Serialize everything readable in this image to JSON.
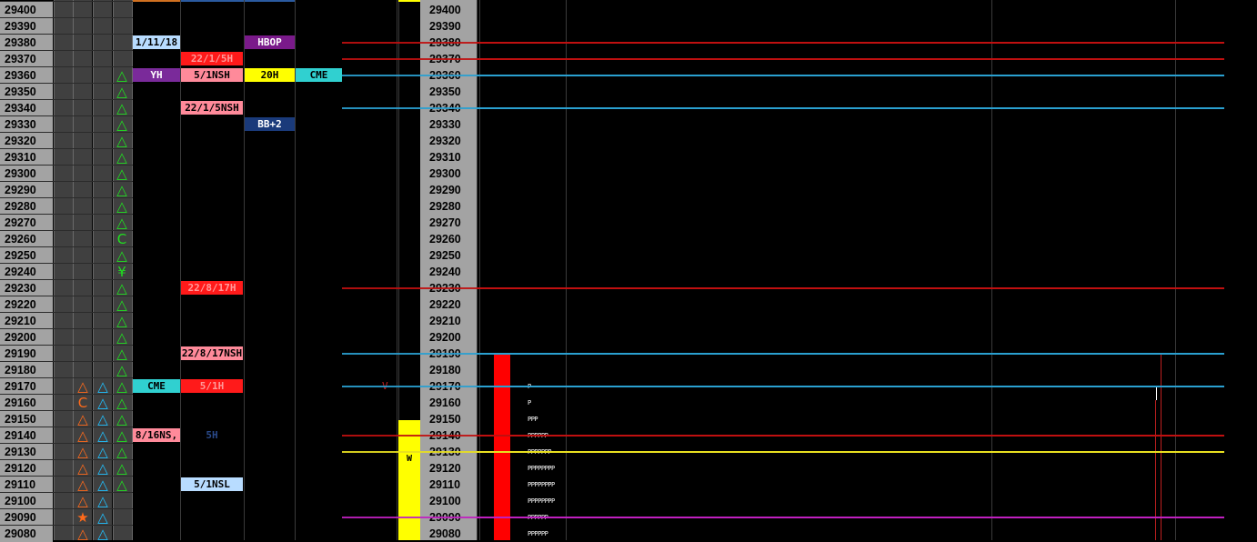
{
  "prices": [
    "29400",
    "29390",
    "29380",
    "29370",
    "29360",
    "29350",
    "29340",
    "29330",
    "29320",
    "29310",
    "29300",
    "29290",
    "29280",
    "29270",
    "29260",
    "29250",
    "29240",
    "29230",
    "29220",
    "29210",
    "29200",
    "29190",
    "29180",
    "29170",
    "29160",
    "29150",
    "29140",
    "29130",
    "29120",
    "29110",
    "29100",
    "29090",
    "29080"
  ],
  "markers": {
    "col1": [
      {
        "row": 23,
        "glyph": "△",
        "color": "#ff6a1a"
      },
      {
        "row": 24,
        "glyph": "C",
        "color": "#ff6a1a"
      },
      {
        "row": 25,
        "glyph": "△",
        "color": "#ff6a1a"
      },
      {
        "row": 26,
        "glyph": "△",
        "color": "#ff6a1a"
      },
      {
        "row": 27,
        "glyph": "△",
        "color": "#ff6a1a"
      },
      {
        "row": 28,
        "glyph": "△",
        "color": "#ff6a1a"
      },
      {
        "row": 29,
        "glyph": "△",
        "color": "#ff6a1a"
      },
      {
        "row": 30,
        "glyph": "△",
        "color": "#ff6a1a"
      },
      {
        "row": 31,
        "glyph": "★",
        "color": "#ff6a1a"
      },
      {
        "row": 32,
        "glyph": "△",
        "color": "#ff6a1a"
      }
    ],
    "col2": [
      {
        "row": 23,
        "glyph": "△",
        "color": "#20c0ff"
      },
      {
        "row": 24,
        "glyph": "△",
        "color": "#20c0ff"
      },
      {
        "row": 25,
        "glyph": "△",
        "color": "#20c0ff"
      },
      {
        "row": 26,
        "glyph": "△",
        "color": "#20c0ff"
      },
      {
        "row": 27,
        "glyph": "△",
        "color": "#20c0ff"
      },
      {
        "row": 28,
        "glyph": "△",
        "color": "#20c0ff"
      },
      {
        "row": 29,
        "glyph": "△",
        "color": "#20c0ff"
      },
      {
        "row": 30,
        "glyph": "△",
        "color": "#20c0ff"
      },
      {
        "row": 31,
        "glyph": "△",
        "color": "#20c0ff"
      },
      {
        "row": 32,
        "glyph": "△",
        "color": "#20c0ff"
      }
    ],
    "col3": [
      {
        "row": 4,
        "glyph": "△",
        "color": "#20e020"
      },
      {
        "row": 5,
        "glyph": "△",
        "color": "#20e020"
      },
      {
        "row": 6,
        "glyph": "△",
        "color": "#20e020"
      },
      {
        "row": 7,
        "glyph": "△",
        "color": "#20e020"
      },
      {
        "row": 8,
        "glyph": "△",
        "color": "#20e020"
      },
      {
        "row": 9,
        "glyph": "△",
        "color": "#20e020"
      },
      {
        "row": 10,
        "glyph": "△",
        "color": "#20e020"
      },
      {
        "row": 11,
        "glyph": "△",
        "color": "#20e020"
      },
      {
        "row": 12,
        "glyph": "△",
        "color": "#20e020"
      },
      {
        "row": 13,
        "glyph": "△",
        "color": "#20e020"
      },
      {
        "row": 14,
        "glyph": "C",
        "color": "#20e020"
      },
      {
        "row": 15,
        "glyph": "△",
        "color": "#20e020"
      },
      {
        "row": 16,
        "glyph": "¥",
        "color": "#20e020"
      },
      {
        "row": 17,
        "glyph": "△",
        "color": "#20e020"
      },
      {
        "row": 18,
        "glyph": "△",
        "color": "#20e020"
      },
      {
        "row": 19,
        "glyph": "△",
        "color": "#20e020"
      },
      {
        "row": 20,
        "glyph": "△",
        "color": "#20e020"
      },
      {
        "row": 21,
        "glyph": "△",
        "color": "#20e020"
      },
      {
        "row": 22,
        "glyph": "△",
        "color": "#20e020"
      },
      {
        "row": 23,
        "glyph": "△",
        "color": "#20e020"
      },
      {
        "row": 24,
        "glyph": "△",
        "color": "#20e020"
      },
      {
        "row": 25,
        "glyph": "△",
        "color": "#20e020"
      },
      {
        "row": 26,
        "glyph": "△",
        "color": "#20e020"
      },
      {
        "row": 27,
        "glyph": "△",
        "color": "#20e020"
      },
      {
        "row": 28,
        "glyph": "△",
        "color": "#20e020"
      },
      {
        "row": 29,
        "glyph": "△",
        "color": "#20e020"
      }
    ]
  },
  "tags": [
    {
      "row": 2,
      "col": "a",
      "text": "1/11/18",
      "bg": "#b8dcff",
      "fg": "#000"
    },
    {
      "row": 3,
      "col": "b",
      "text": "22/1/5H",
      "bg": "#ff1a1a",
      "fg": "#ff9a9a"
    },
    {
      "row": 2,
      "col": "c",
      "text": "HBOP",
      "bg": "#7a1a8a",
      "fg": "#ffffff"
    },
    {
      "row": 4,
      "col": "a",
      "text": "YH",
      "bg": "#7a2a9a",
      "fg": "#ffffff"
    },
    {
      "row": 4,
      "col": "b",
      "text": "5/1NSH",
      "bg": "#ff8a9a",
      "fg": "#000"
    },
    {
      "row": 4,
      "col": "c",
      "text": "20H",
      "bg": "#ffff00",
      "fg": "#000"
    },
    {
      "row": 4,
      "col": "d",
      "text": "CME",
      "bg": "#30d0d0",
      "fg": "#000"
    },
    {
      "row": 6,
      "col": "b",
      "text": "22/1/5NSH",
      "bg": "#ff8a9a",
      "fg": "#000"
    },
    {
      "row": 7,
      "col": "c",
      "text": "BB+2",
      "bg": "#1a3a7a",
      "fg": "#ffffff"
    },
    {
      "row": 17,
      "col": "b",
      "text": "22/8/17H",
      "bg": "#ff1a1a",
      "fg": "#ff9a9a"
    },
    {
      "row": 21,
      "col": "b",
      "text": "22/8/17NSH",
      "bg": "#ff8a9a",
      "fg": "#000"
    },
    {
      "row": 23,
      "col": "a",
      "text": "CME",
      "bg": "#30d0d0",
      "fg": "#000"
    },
    {
      "row": 23,
      "col": "b",
      "text": "5/1H",
      "bg": "#ff1a1a",
      "fg": "#ff9a9a"
    },
    {
      "row": 26,
      "col": "a",
      "text": "8/16NS,",
      "bg": "#ff8a9a",
      "fg": "#000"
    },
    {
      "row": 26,
      "col": "b",
      "text": "5H",
      "bg": "#000000",
      "fg": "#2a4a8a"
    },
    {
      "row": 29,
      "col": "b",
      "text": "5/1NSL",
      "bg": "#b8dcff",
      "fg": "#000"
    }
  ],
  "side_markers": [
    {
      "row": 23,
      "text": "V",
      "color": "#c02020"
    }
  ],
  "yellow_bar": {
    "top_row": 26,
    "label": "W",
    "color": "#ffff00"
  },
  "red_bar": {
    "top_row": 21,
    "color": "#ff0000"
  },
  "hlines": [
    {
      "row": 2,
      "color": "#c01010"
    },
    {
      "row": 3,
      "color": "#c01010"
    },
    {
      "row": 4,
      "color": "#2aa0d0"
    },
    {
      "row": 6,
      "color": "#2aa0d0"
    },
    {
      "row": 17,
      "color": "#c01010"
    },
    {
      "row": 21,
      "color": "#2aa0d0"
    },
    {
      "row": 23,
      "color": "#2aa0d0"
    },
    {
      "row": 26,
      "color": "#c01010"
    },
    {
      "row": 27,
      "color": "#e8e020"
    },
    {
      "row": 31,
      "color": "#c020c0"
    }
  ],
  "tpo": [
    {
      "row": 23,
      "text": "P"
    },
    {
      "row": 24,
      "text": "P"
    },
    {
      "row": 25,
      "text": "PPP"
    },
    {
      "row": 26,
      "text": "PPPPPP"
    },
    {
      "row": 27,
      "text": "PPPPPPP"
    },
    {
      "row": 28,
      "text": "PPPPPPPP"
    },
    {
      "row": 29,
      "text": "PPPPPPPP"
    },
    {
      "row": 30,
      "text": "PPPPPPPP"
    },
    {
      "row": 31,
      "text": "PPPPPP"
    },
    {
      "row": 32,
      "text": "PPPPPP"
    }
  ]
}
